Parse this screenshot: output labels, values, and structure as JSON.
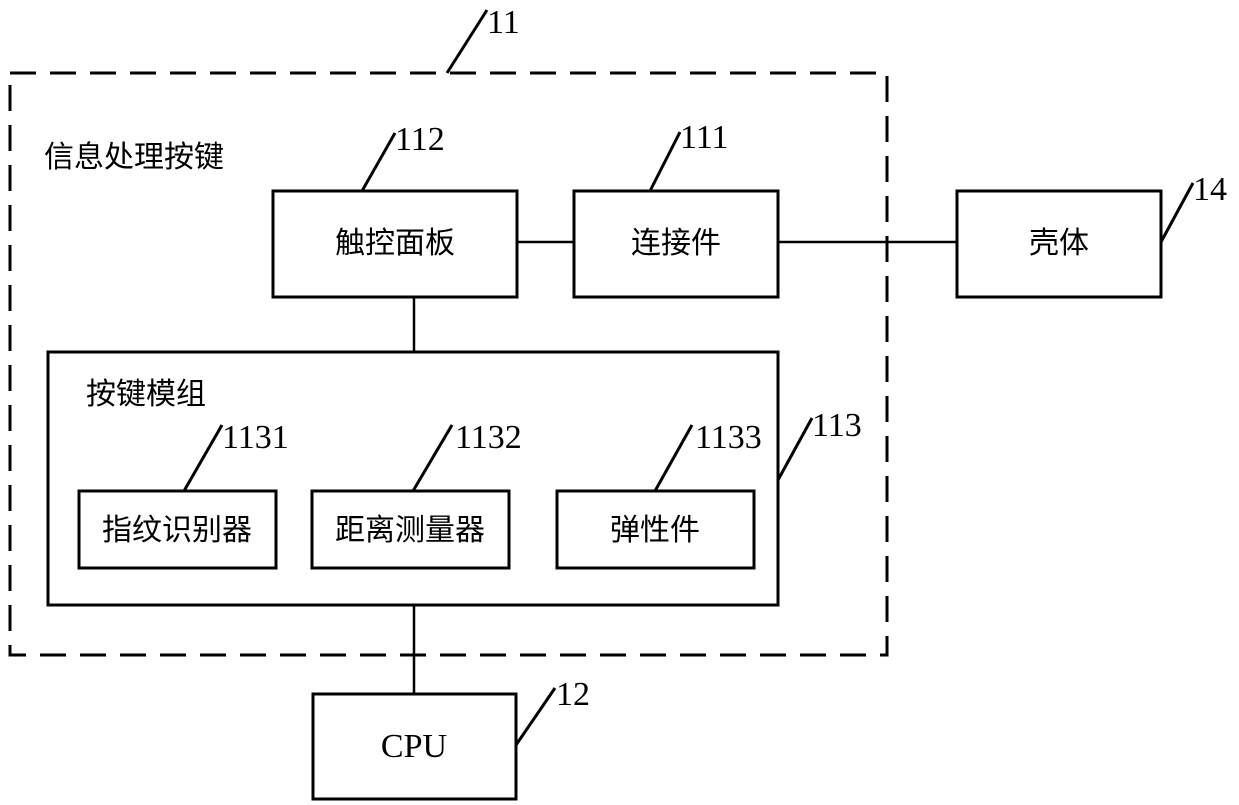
{
  "diagram": {
    "outer_group": {
      "label": "信息处理按键",
      "ref": "11"
    },
    "nodes": {
      "touch_panel": {
        "label": "触控面板",
        "ref": "112"
      },
      "connector": {
        "label": "连接件",
        "ref": "111"
      },
      "housing": {
        "label": "壳体",
        "ref": "14"
      },
      "key_module": {
        "label": "按键模组",
        "ref": "113"
      },
      "fingerprint": {
        "label": "指纹识别器",
        "ref": "1131"
      },
      "distance": {
        "label": "距离测量器",
        "ref": "1132"
      },
      "elastic": {
        "label": "弹性件",
        "ref": "1133"
      },
      "cpu": {
        "label": "CPU",
        "ref": "12"
      }
    },
    "edges": [
      [
        "touch_panel",
        "connector"
      ],
      [
        "connector",
        "housing"
      ],
      [
        "touch_panel",
        "key_module"
      ],
      [
        "key_module",
        "cpu"
      ]
    ]
  }
}
